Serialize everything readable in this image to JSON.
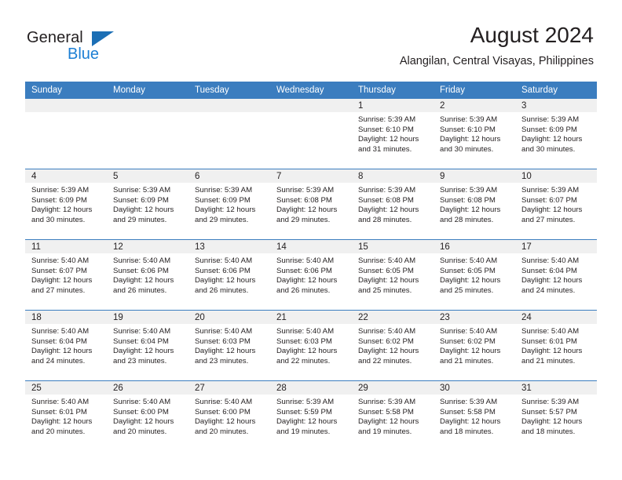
{
  "brand": {
    "name_top": "General",
    "name_bottom": "Blue",
    "accent_color": "#1c7fd4",
    "triangle_color": "#1c6fb5"
  },
  "header": {
    "title": "August 2024",
    "location": "Alangilan, Central Visayas, Philippines"
  },
  "calendar": {
    "header_bg": "#3b7dbf",
    "daynum_bg": "#f0f0f0",
    "weekdays": [
      "Sunday",
      "Monday",
      "Tuesday",
      "Wednesday",
      "Thursday",
      "Friday",
      "Saturday"
    ],
    "weeks": [
      [
        {
          "day": "",
          "empty": true,
          "lines": []
        },
        {
          "day": "",
          "empty": true,
          "lines": []
        },
        {
          "day": "",
          "empty": true,
          "lines": []
        },
        {
          "day": "",
          "empty": true,
          "lines": []
        },
        {
          "day": "1",
          "lines": [
            "Sunrise: 5:39 AM",
            "Sunset: 6:10 PM",
            "Daylight: 12 hours",
            "and 31 minutes."
          ]
        },
        {
          "day": "2",
          "lines": [
            "Sunrise: 5:39 AM",
            "Sunset: 6:10 PM",
            "Daylight: 12 hours",
            "and 30 minutes."
          ]
        },
        {
          "day": "3",
          "lines": [
            "Sunrise: 5:39 AM",
            "Sunset: 6:09 PM",
            "Daylight: 12 hours",
            "and 30 minutes."
          ]
        }
      ],
      [
        {
          "day": "4",
          "lines": [
            "Sunrise: 5:39 AM",
            "Sunset: 6:09 PM",
            "Daylight: 12 hours",
            "and 30 minutes."
          ]
        },
        {
          "day": "5",
          "lines": [
            "Sunrise: 5:39 AM",
            "Sunset: 6:09 PM",
            "Daylight: 12 hours",
            "and 29 minutes."
          ]
        },
        {
          "day": "6",
          "lines": [
            "Sunrise: 5:39 AM",
            "Sunset: 6:09 PM",
            "Daylight: 12 hours",
            "and 29 minutes."
          ]
        },
        {
          "day": "7",
          "lines": [
            "Sunrise: 5:39 AM",
            "Sunset: 6:08 PM",
            "Daylight: 12 hours",
            "and 29 minutes."
          ]
        },
        {
          "day": "8",
          "lines": [
            "Sunrise: 5:39 AM",
            "Sunset: 6:08 PM",
            "Daylight: 12 hours",
            "and 28 minutes."
          ]
        },
        {
          "day": "9",
          "lines": [
            "Sunrise: 5:39 AM",
            "Sunset: 6:08 PM",
            "Daylight: 12 hours",
            "and 28 minutes."
          ]
        },
        {
          "day": "10",
          "lines": [
            "Sunrise: 5:39 AM",
            "Sunset: 6:07 PM",
            "Daylight: 12 hours",
            "and 27 minutes."
          ]
        }
      ],
      [
        {
          "day": "11",
          "lines": [
            "Sunrise: 5:40 AM",
            "Sunset: 6:07 PM",
            "Daylight: 12 hours",
            "and 27 minutes."
          ]
        },
        {
          "day": "12",
          "lines": [
            "Sunrise: 5:40 AM",
            "Sunset: 6:06 PM",
            "Daylight: 12 hours",
            "and 26 minutes."
          ]
        },
        {
          "day": "13",
          "lines": [
            "Sunrise: 5:40 AM",
            "Sunset: 6:06 PM",
            "Daylight: 12 hours",
            "and 26 minutes."
          ]
        },
        {
          "day": "14",
          "lines": [
            "Sunrise: 5:40 AM",
            "Sunset: 6:06 PM",
            "Daylight: 12 hours",
            "and 26 minutes."
          ]
        },
        {
          "day": "15",
          "lines": [
            "Sunrise: 5:40 AM",
            "Sunset: 6:05 PM",
            "Daylight: 12 hours",
            "and 25 minutes."
          ]
        },
        {
          "day": "16",
          "lines": [
            "Sunrise: 5:40 AM",
            "Sunset: 6:05 PM",
            "Daylight: 12 hours",
            "and 25 minutes."
          ]
        },
        {
          "day": "17",
          "lines": [
            "Sunrise: 5:40 AM",
            "Sunset: 6:04 PM",
            "Daylight: 12 hours",
            "and 24 minutes."
          ]
        }
      ],
      [
        {
          "day": "18",
          "lines": [
            "Sunrise: 5:40 AM",
            "Sunset: 6:04 PM",
            "Daylight: 12 hours",
            "and 24 minutes."
          ]
        },
        {
          "day": "19",
          "lines": [
            "Sunrise: 5:40 AM",
            "Sunset: 6:04 PM",
            "Daylight: 12 hours",
            "and 23 minutes."
          ]
        },
        {
          "day": "20",
          "lines": [
            "Sunrise: 5:40 AM",
            "Sunset: 6:03 PM",
            "Daylight: 12 hours",
            "and 23 minutes."
          ]
        },
        {
          "day": "21",
          "lines": [
            "Sunrise: 5:40 AM",
            "Sunset: 6:03 PM",
            "Daylight: 12 hours",
            "and 22 minutes."
          ]
        },
        {
          "day": "22",
          "lines": [
            "Sunrise: 5:40 AM",
            "Sunset: 6:02 PM",
            "Daylight: 12 hours",
            "and 22 minutes."
          ]
        },
        {
          "day": "23",
          "lines": [
            "Sunrise: 5:40 AM",
            "Sunset: 6:02 PM",
            "Daylight: 12 hours",
            "and 21 minutes."
          ]
        },
        {
          "day": "24",
          "lines": [
            "Sunrise: 5:40 AM",
            "Sunset: 6:01 PM",
            "Daylight: 12 hours",
            "and 21 minutes."
          ]
        }
      ],
      [
        {
          "day": "25",
          "lines": [
            "Sunrise: 5:40 AM",
            "Sunset: 6:01 PM",
            "Daylight: 12 hours",
            "and 20 minutes."
          ]
        },
        {
          "day": "26",
          "lines": [
            "Sunrise: 5:40 AM",
            "Sunset: 6:00 PM",
            "Daylight: 12 hours",
            "and 20 minutes."
          ]
        },
        {
          "day": "27",
          "lines": [
            "Sunrise: 5:40 AM",
            "Sunset: 6:00 PM",
            "Daylight: 12 hours",
            "and 20 minutes."
          ]
        },
        {
          "day": "28",
          "lines": [
            "Sunrise: 5:39 AM",
            "Sunset: 5:59 PM",
            "Daylight: 12 hours",
            "and 19 minutes."
          ]
        },
        {
          "day": "29",
          "lines": [
            "Sunrise: 5:39 AM",
            "Sunset: 5:58 PM",
            "Daylight: 12 hours",
            "and 19 minutes."
          ]
        },
        {
          "day": "30",
          "lines": [
            "Sunrise: 5:39 AM",
            "Sunset: 5:58 PM",
            "Daylight: 12 hours",
            "and 18 minutes."
          ]
        },
        {
          "day": "31",
          "lines": [
            "Sunrise: 5:39 AM",
            "Sunset: 5:57 PM",
            "Daylight: 12 hours",
            "and 18 minutes."
          ]
        }
      ]
    ]
  }
}
